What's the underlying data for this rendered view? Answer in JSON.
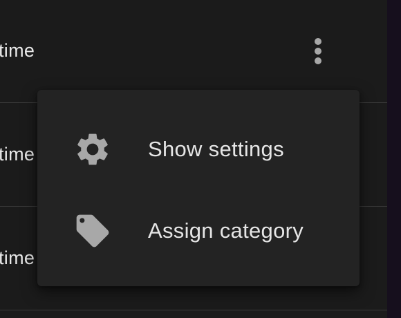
{
  "list": {
    "rows": [
      {
        "label": "time"
      },
      {
        "label": "time"
      },
      {
        "label": "time"
      }
    ]
  },
  "toolbar": {
    "more_icon": "more-vert-icon"
  },
  "menu": {
    "items": [
      {
        "label": "Show settings",
        "icon": "gear-icon"
      },
      {
        "label": "Assign category",
        "icon": "tag-icon"
      }
    ]
  },
  "colors": {
    "background": "#1b1b1b",
    "menu_background": "#232323",
    "text": "#e6e6e6",
    "icon": "#a8a8a8",
    "divider": "#3a3a3a",
    "edge": "#160f1d"
  }
}
